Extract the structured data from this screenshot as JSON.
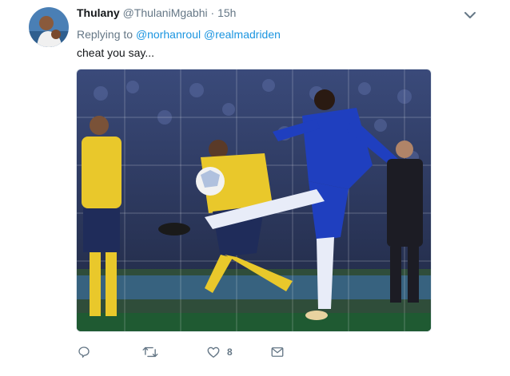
{
  "tweet": {
    "display_name": "Thulany",
    "handle": "@ThulaniMgabhi",
    "separator": "·",
    "time": "15h",
    "replying_prefix": "Replying to",
    "mentions": [
      "@norhanroul",
      "@realmadriden"
    ],
    "text": "cheat you say...",
    "media_description": "Football photo: player in blue kit mid-kick striking the ball near players in yellow kit",
    "actions": {
      "reply_count": "",
      "retweet_count": "",
      "like_count": "8"
    }
  },
  "icons": {
    "menu": "chevron-down-icon",
    "reply": "reply-icon",
    "retweet": "retweet-icon",
    "like": "heart-icon",
    "dm": "envelope-icon"
  },
  "colors": {
    "accent": "#1b95e0",
    "secondary_text": "#657786",
    "primary_text": "#14171a",
    "icon_gray": "#657786"
  }
}
